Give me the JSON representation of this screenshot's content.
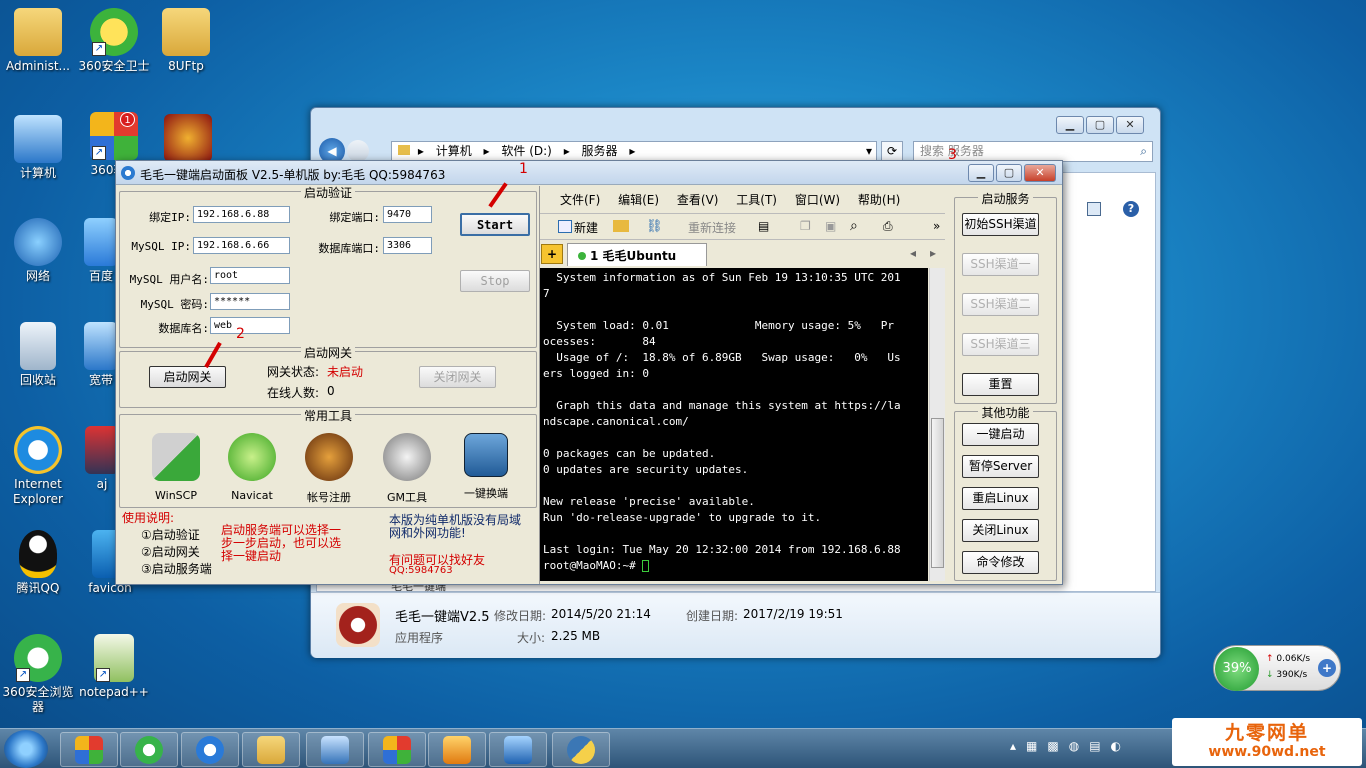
{
  "desktop": {
    "icons": [
      {
        "label": "Administ..."
      },
      {
        "label": "360安全卫士"
      },
      {
        "label": "8UFtp"
      },
      {
        "label": "计算机"
      },
      {
        "label": "360软件"
      },
      {
        "label": "网络"
      },
      {
        "label": "百度"
      },
      {
        "label": "回收站"
      },
      {
        "label": "宽带"
      },
      {
        "label": "Internet Explorer"
      },
      {
        "label": "aj"
      },
      {
        "label": "腾讯QQ"
      },
      {
        "label": "favicon"
      },
      {
        "label": "360安全浏览器"
      },
      {
        "label": "notepad++"
      }
    ],
    "notify_badge": "1"
  },
  "explorer": {
    "address": [
      "计算机",
      "软件 (D:)",
      "服务器"
    ],
    "search_placeholder": "搜索 服务器",
    "file": {
      "name": "毛毛一键端V2.5",
      "modified_label": "修改日期:",
      "modified": "2014/5/20 21:14",
      "created_label": "创建日期:",
      "created": "2017/2/19 19:51",
      "type": "应用程序",
      "size_label": "大小:",
      "size": "2.25 MB"
    },
    "behind_text": "毛毛一键端"
  },
  "app": {
    "title": "毛毛一键端启动面板 V2.5-单机版 by:毛毛  QQ:5984763",
    "verify": {
      "group_title": "启动验证",
      "bind_ip_label": "绑定IP:",
      "bind_ip": "192.168.6.88",
      "bind_port_label": "绑定端口:",
      "bind_port": "9470",
      "mysql_ip_label": "MySQL IP:",
      "mysql_ip": "192.168.6.66",
      "db_port_label": "数据库端口:",
      "db_port": "3306",
      "mysql_user_label": "MySQL 用户名:",
      "mysql_user": "root",
      "mysql_pwd_label": "MySQL 密码:",
      "mysql_pwd": "******",
      "db_name_label": "数据库名:",
      "db_name": "web",
      "start": "Start",
      "stop": "Stop"
    },
    "gateway": {
      "group_title": "启动网关",
      "start_btn": "启动网关",
      "status_label": "网关状态:",
      "status": "未启动",
      "online_label": "在线人数:",
      "online": "0",
      "close_btn": "关闭网关"
    },
    "tools": {
      "group_title": "常用工具",
      "items": [
        "WinSCP",
        "Navicat",
        "帐号注册",
        "GM工具",
        "一键换端"
      ]
    },
    "help": {
      "title": "使用说明:",
      "steps": [
        "①启动验证",
        "②启动网关",
        "③启动服务端"
      ],
      "note1": "启动服务端可以选择一步一步启动，也可以选择一键启动",
      "note2": "本版为纯单机版没有局域网和外网功能!",
      "note3": "有问题可以找好友",
      "qq": "QQ:5984763"
    },
    "annotations": [
      "1",
      "2",
      "3"
    ],
    "terminal": {
      "menu": [
        "文件(F)",
        "编辑(E)",
        "查看(V)",
        "工具(T)",
        "窗口(W)",
        "帮助(H)"
      ],
      "toolbar_new": "新建",
      "toolbar_reconnect": "重新连接",
      "tab": "1 毛毛Ubuntu",
      "lines": [
        "  System information as of Sun Feb 19 13:10:35 UTC 201",
        "7",
        "",
        "  System load: 0.01             Memory usage: 5%   Pr",
        "ocesses:       84",
        "  Usage of /:  18.8% of 6.89GB   Swap usage:   0%   Us",
        "ers logged in: 0",
        "",
        "  Graph this data and manage this system at https://la",
        "ndscape.canonical.com/",
        "",
        "0 packages can be updated.",
        "0 updates are security updates.",
        "",
        "New release 'precise' available.",
        "Run 'do-release-upgrade' to upgrade to it.",
        "",
        "Last login: Tue May 20 12:32:00 2014 from 192.168.6.88",
        "root@MaoMAO:~# "
      ]
    },
    "service": {
      "group_title": "启动服务",
      "init": "初始SSH渠道",
      "ssh1": "SSH渠道一",
      "ssh2": "SSH渠道二",
      "ssh3": "SSH渠道三",
      "reset": "重置"
    },
    "other": {
      "group_title": "其他功能",
      "one_key": "一键启动",
      "pause": "暂停Server",
      "restart": "重启Linux",
      "shutdown": "关闭Linux",
      "cmd": "命令修改"
    }
  },
  "netmon": {
    "percent": "39%",
    "up": "0.06K/s",
    "down": "390K/s"
  },
  "watermark": {
    "title": "九零网单",
    "url": "www.90wd.net"
  }
}
